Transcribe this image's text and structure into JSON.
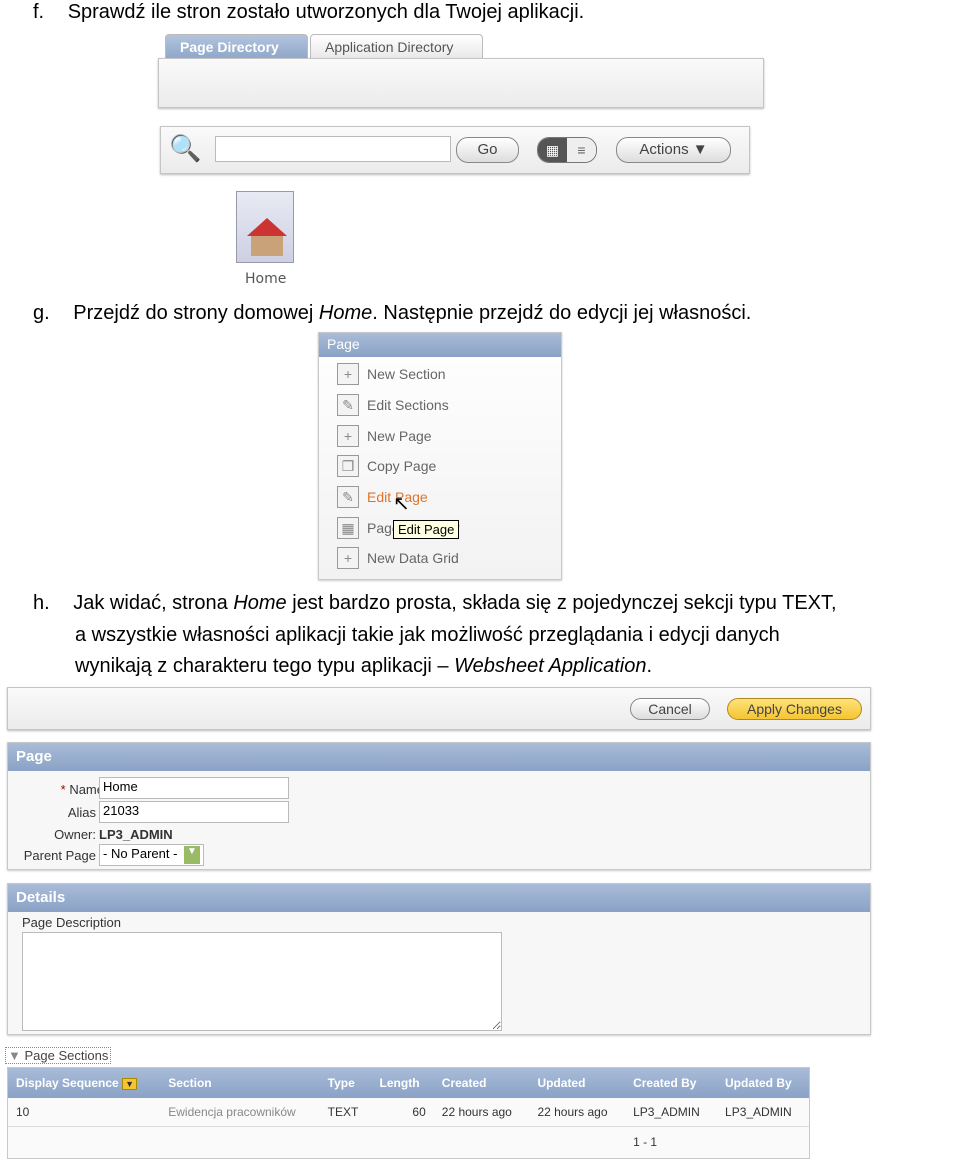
{
  "steps": {
    "f": {
      "marker": "f.",
      "text": "Sprawdź ile stron zostało utworzonych dla Twojej aplikacji."
    },
    "g": {
      "marker": "g.",
      "text_before": "Przejdź do strony domowej ",
      "text_em": "Home",
      "text_after": ". Następnie przejdź do edycji jej własności."
    },
    "h": {
      "marker": "h.",
      "line1_before": "Jak widać, strona ",
      "line1_em": "Home",
      "line1_after": " jest bardzo prosta, składa się z pojedynczej sekcji typu TEXT,",
      "line2": "a wszystkie własności aplikacji takie jak możliwość przeglądania i edycji danych",
      "line3_before": "wynikają z charakteru tego typu aplikacji – ",
      "line3_em": "Websheet Application",
      "line3_after": "."
    }
  },
  "directory": {
    "tabs": [
      {
        "label": "Page Directory",
        "active": true
      },
      {
        "label": "Application Directory",
        "active": false
      }
    ],
    "search": {
      "value": "",
      "go_label": "Go",
      "actions_label": "Actions",
      "icon": "magnifier-icon"
    },
    "pages": [
      {
        "label": "Home",
        "icon": "home-page-icon"
      }
    ]
  },
  "page_menu": {
    "title": "Page",
    "items": [
      {
        "label": "New Section"
      },
      {
        "label": "Edit Sections"
      },
      {
        "label": "New Page"
      },
      {
        "label": "Copy Page"
      },
      {
        "label": "Edit Page",
        "hover": true
      },
      {
        "label": "Page Directory"
      },
      {
        "label": "New Data Grid"
      }
    ],
    "tooltip": "Edit Page",
    "hover_color": "#e0722b"
  },
  "edit": {
    "cancel_label": "Cancel",
    "apply_label": "Apply Changes",
    "page_panel": {
      "title": "Page",
      "required_mark": "*",
      "name_label": "Name",
      "name_value": "Home",
      "alias_label": "Alias",
      "alias_value": "21033",
      "owner_label": "Owner:",
      "owner_value": "LP3_ADMIN",
      "parent_label": "Parent Page",
      "parent_value": "- No Parent -"
    },
    "details_panel": {
      "title": "Details",
      "description_label": "Page Description",
      "description_value": ""
    },
    "sections": {
      "title": "Page Sections",
      "columns": [
        "Display Sequence",
        "Section",
        "Type",
        "Length",
        "Created",
        "Updated",
        "Created By",
        "Updated By"
      ],
      "rows": [
        [
          "10",
          "Ewidencja pracowników",
          "TEXT",
          "60",
          "22 hours ago",
          "22 hours ago",
          "LP3_ADMIN",
          "LP3_ADMIN"
        ]
      ],
      "pagination": "1 - 1"
    }
  },
  "colors": {
    "header_blue": "#8aa2c6",
    "apply_yellow": "#f5c531"
  }
}
